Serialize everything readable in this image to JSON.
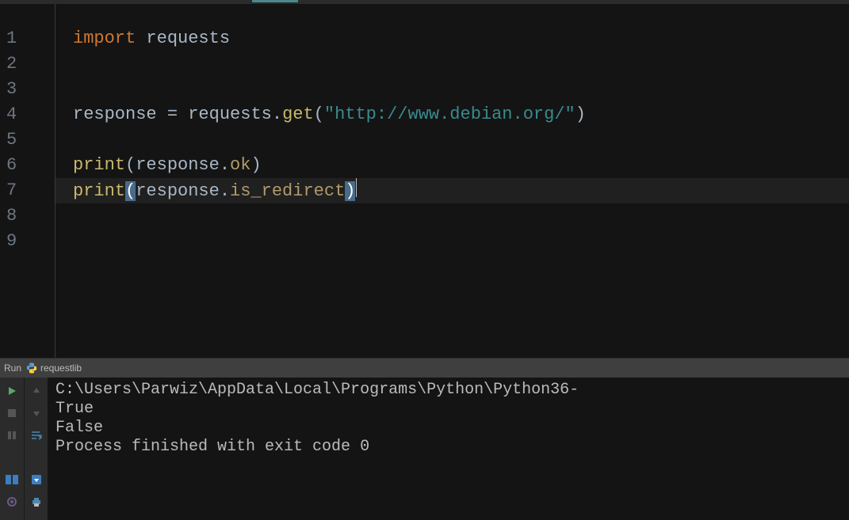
{
  "lineNumbers": [
    "1",
    "2",
    "3",
    "4",
    "5",
    "6",
    "7",
    "8",
    "9"
  ],
  "code": {
    "l1": {
      "kw": "import",
      "sp": " ",
      "mod": "requests"
    },
    "l4": {
      "v": "response",
      "sp": " ",
      "eq": "=",
      "sp2": " ",
      "mod": "requests",
      "dot": ".",
      "fn": "get",
      "lp": "(",
      "str": "\"http://www.debian.org/\"",
      "rp": ")"
    },
    "l6": {
      "fn": "print",
      "lp": "(",
      "obj": "response",
      "dot": ".",
      "attr": "ok",
      "rp": ")"
    },
    "l7": {
      "fn": "print",
      "lp": "(",
      "obj": "response",
      "dot": ".",
      "attr": "is_redirect",
      "rp": ")"
    }
  },
  "runPanel": {
    "title": "Run",
    "configName": "requestlib"
  },
  "console": {
    "path": "C:\\Users\\Parwiz\\AppData\\Local\\Programs\\Python\\Python36-",
    "out1": "True",
    "out2": "False",
    "empty": "",
    "exit": "Process finished with exit code 0"
  }
}
